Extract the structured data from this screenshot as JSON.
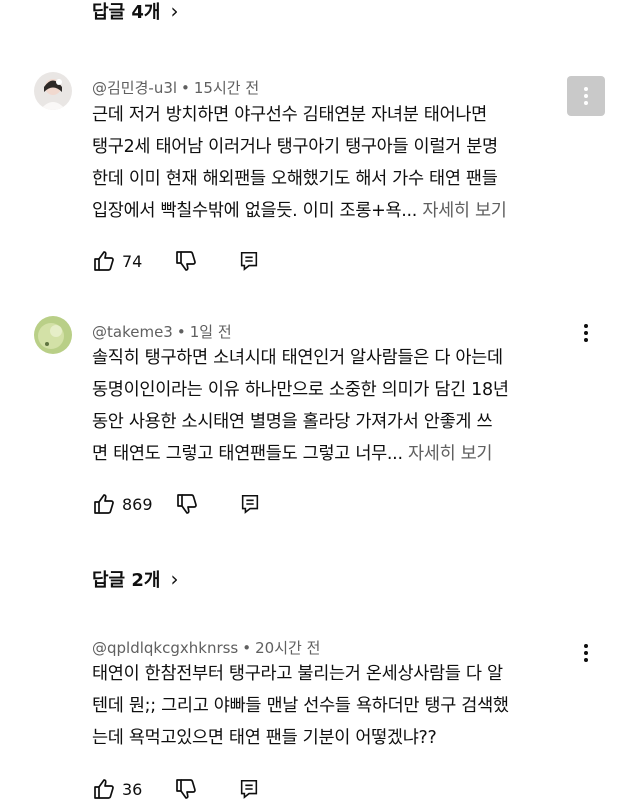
{
  "top_replies": {
    "label": "답글 4개",
    "chevron": "chevron-right-icon"
  },
  "comments": [
    {
      "author": "@김민경-u3l",
      "time": "15시간 전",
      "text": "근데 저거 방치하면 야구선수 김태연분 자녀분 태어나면\n탱구2세 태어남 이러거나 탱구아기 탱구아들 이럴거 분명\n한데 이미 현재 해외팬들 오해했기도 해서 가수 태연 팬들\n입장에서 빡칠수밖에 없을듯. 이미 조롱+욕... ",
      "more": "자세히 보기",
      "likes": "74"
    },
    {
      "author": "@takeme3",
      "time": "1일 전",
      "text": "솔직히 탱구하면 소녀시대 태연인거 알사람들은 다 아는데\n동명이인이라는 이유 하나만으로 소중한 의미가 담긴 18년\n동안 사용한 소시태연 별명을 홀라당 가져가서 안좋게 쓰\n면 태연도 그렇고 태연팬들도 그렇고 너무... ",
      "more": "자세히 보기",
      "likes": "869",
      "replies": "답글 2개"
    },
    {
      "author": "@qpldlqkcgxhknrss",
      "time": "20시간 전",
      "text": "태연이 한참전부터 탱구라고 불리는거 온세상사람들 다 알\n텐데 뭔;; 그리고 야빠들 맨날 선수들 욕하더만 탱구 검색했\n는데 욕먹고있으면 태연 팬들 기분이 어떻겠냐??",
      "likes": "36"
    }
  ],
  "colors": {
    "text": "#0f0f0f",
    "secondary": "#606060",
    "kebab_box": "#c9c9c9"
  }
}
